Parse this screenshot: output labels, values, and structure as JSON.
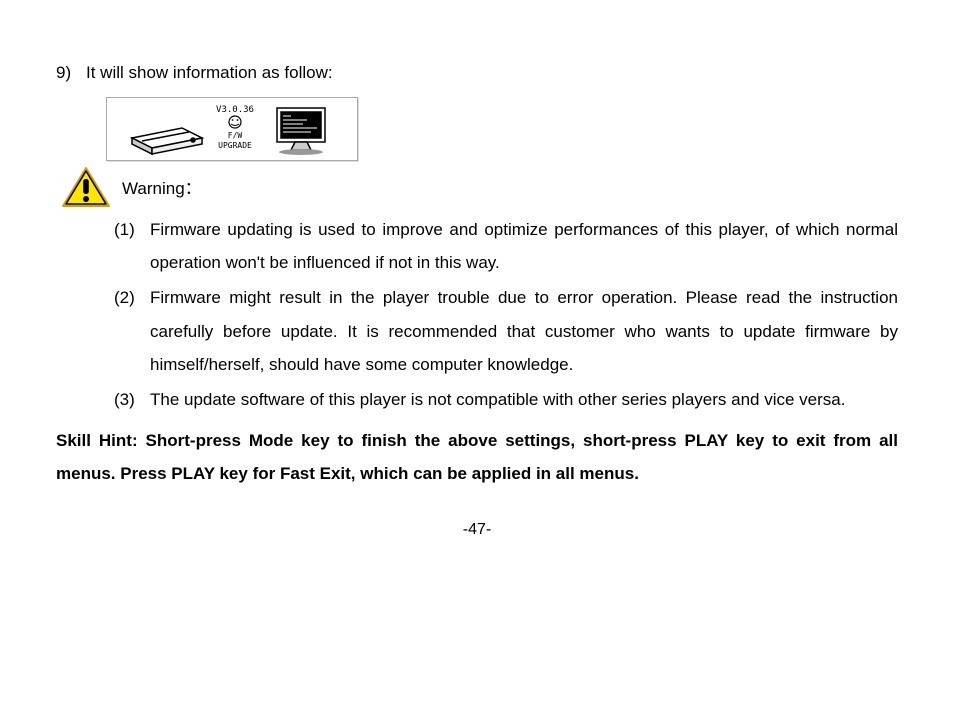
{
  "step": {
    "num": "9)",
    "text": "It will show information as follow:"
  },
  "illus": {
    "line1": "V3.0.36",
    "line2": "F/W",
    "line3": "UPGRADE"
  },
  "warning_label": "Warning：",
  "warnings": [
    {
      "num": "(1)",
      "text": "Firmware updating is used to improve and optimize performances of this player, of which normal operation won't be influenced if not in this way."
    },
    {
      "num": "(2)",
      "text": "Firmware might result in the player trouble due to error operation. Please read the instruction carefully before update.  It is recommended that customer who wants to update firmware by himself/herself, should have some computer knowledge."
    },
    {
      "num": "(3)",
      "text": "The update software of this player is not compatible with other series players and vice versa."
    }
  ],
  "hint": "Skill Hint: Short-press Mode key to finish the above settings, short-press PLAY key to exit from all menus. Press PLAY key for Fast Exit, which can be applied in all menus.",
  "page_num": "-47-"
}
